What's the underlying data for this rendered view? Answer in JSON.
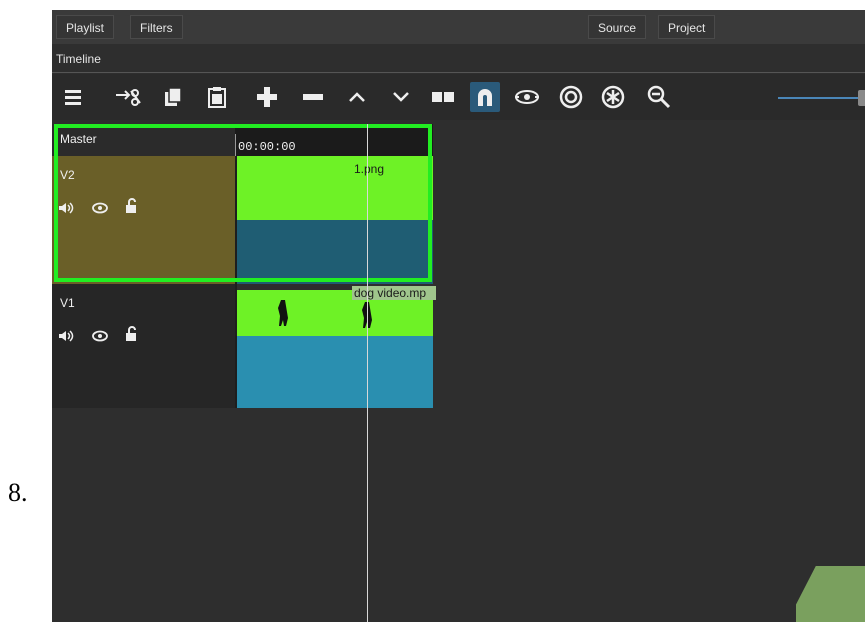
{
  "step": {
    "number": "8."
  },
  "tabs": {
    "playlist": "Playlist",
    "filters": "Filters",
    "source": "Source",
    "project": "Project"
  },
  "timeline": {
    "title": "Timeline",
    "master_label": "Master",
    "timecode": "00:00:00",
    "tracks": [
      {
        "name": "V2",
        "clip": "1.png"
      },
      {
        "name": "V1",
        "clip": "dog video.mp"
      }
    ]
  },
  "toolbar": {
    "icons": [
      "menu-icon",
      "cut-icon",
      "copy-icon",
      "paste-icon",
      "append-icon",
      "remove-icon",
      "lift-icon",
      "overwrite-icon",
      "split-icon",
      "snap-icon",
      "scrub-icon",
      "ripple-icon",
      "ripple-all-icon",
      "zoom-out-icon"
    ],
    "active": "snap-icon"
  },
  "colors": {
    "selection": "#22ee22",
    "clip_top": "#6ef226",
    "clip_bottom": "#2a8fb0",
    "v2_header": "#6a5f28",
    "accent": "#2a5a7a"
  }
}
